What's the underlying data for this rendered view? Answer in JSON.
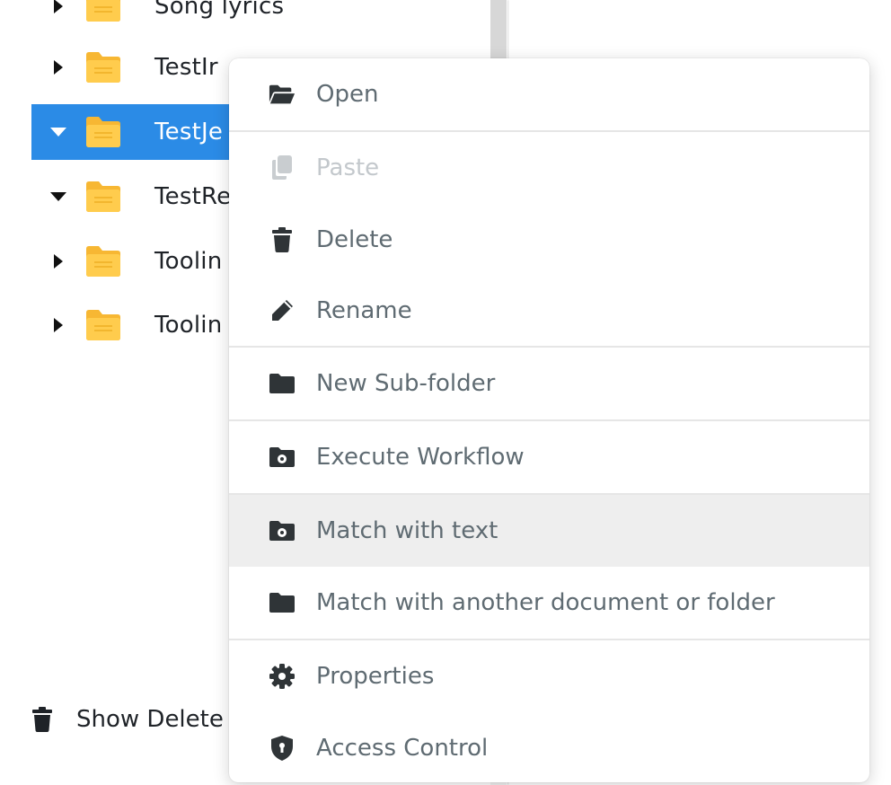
{
  "tree": {
    "items": [
      {
        "label": "Song lyrics",
        "expanded": false,
        "selected": false
      },
      {
        "label": "TestIr",
        "expanded": false,
        "selected": false
      },
      {
        "label": "TestJe",
        "expanded": true,
        "selected": true
      },
      {
        "label": "TestRe",
        "expanded": true,
        "selected": false
      },
      {
        "label": "Toolin",
        "expanded": false,
        "selected": false
      },
      {
        "label": "Toolin",
        "expanded": false,
        "selected": false
      }
    ],
    "show_deleted_label": "Show Delete"
  },
  "context_menu": {
    "items": [
      {
        "label": "Open",
        "icon": "folder-open-icon",
        "disabled": false
      },
      {
        "label": "Paste",
        "icon": "paste-icon",
        "disabled": true
      },
      {
        "label": "Delete",
        "icon": "trash-icon",
        "disabled": false
      },
      {
        "label": "Rename",
        "icon": "pencil-icon",
        "disabled": false
      },
      {
        "label": "New Sub-folder",
        "icon": "folder-icon",
        "disabled": false
      },
      {
        "label": "Execute Workflow",
        "icon": "folder-gear-icon",
        "disabled": false
      },
      {
        "label": "Match with text",
        "icon": "folder-gear-icon",
        "disabled": false,
        "hovered": true
      },
      {
        "label": "Match with another document or folder",
        "icon": "folder-icon",
        "disabled": false
      },
      {
        "label": "Properties",
        "icon": "gear-icon",
        "disabled": false
      },
      {
        "label": "Access Control",
        "icon": "shield-icon",
        "disabled": false
      }
    ]
  },
  "colors": {
    "selection": "#2b8be6",
    "folder": "#ffc83d",
    "menu_text": "#5f6b72",
    "menu_hover": "#eeeeee"
  }
}
